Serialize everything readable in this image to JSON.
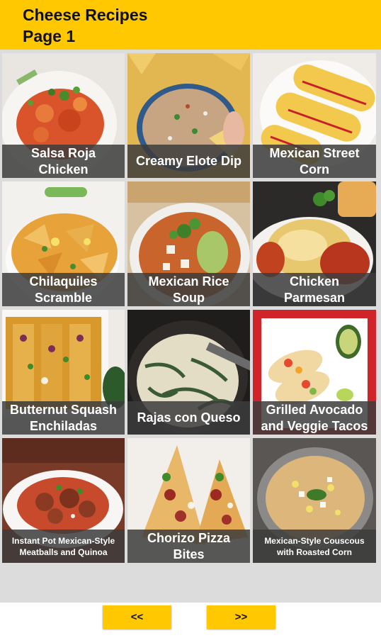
{
  "header": {
    "title_line1": "Cheese Recipes",
    "title_line2": "Page 1"
  },
  "recipes": [
    {
      "title_line1": "Salsa Roja",
      "title_line2": "Chicken",
      "image": "salsa-roja-chicken-photo"
    },
    {
      "title_line1": "Creamy Elote Dip",
      "title_line2": "",
      "image": "creamy-elote-dip-photo"
    },
    {
      "title_line1": "Mexican Street",
      "title_line2": "Corn",
      "image": "mexican-street-corn-photo"
    },
    {
      "title_line1": "Chilaquiles",
      "title_line2": "Scramble",
      "image": "chilaquiles-scramble-photo"
    },
    {
      "title_line1": "Mexican Rice",
      "title_line2": "Soup",
      "image": "mexican-rice-soup-photo"
    },
    {
      "title_line1": "Chicken",
      "title_line2": "Parmesan",
      "image": "chicken-parmesan-photo"
    },
    {
      "title_line1": "Butternut Squash",
      "title_line2": "Enchiladas",
      "image": "butternut-squash-enchiladas-photo"
    },
    {
      "title_line1": "Rajas con Queso",
      "title_line2": "",
      "image": "rajas-con-queso-photo"
    },
    {
      "title_line1": "Grilled Avocado",
      "title_line2": "and Veggie Tacos",
      "image": "grilled-avocado-tacos-photo"
    },
    {
      "title_line1": "Instant Pot Mexican-Style",
      "title_line2": "Meatballs and Quinoa",
      "image": "meatballs-quinoa-photo"
    },
    {
      "title_line1": "Chorizo Pizza",
      "title_line2": "Bites",
      "image": "chorizo-pizza-bites-photo"
    },
    {
      "title_line1": "Mexican-Style Couscous",
      "title_line2": "with Roasted Corn",
      "image": "couscous-roasted-corn-photo"
    }
  ],
  "nav": {
    "prev_label": "<<",
    "next_label": ">>"
  },
  "colors": {
    "accent": "#FFC800",
    "label_overlay": "#3c3c3c",
    "grid_background": "#dcdcdc"
  }
}
